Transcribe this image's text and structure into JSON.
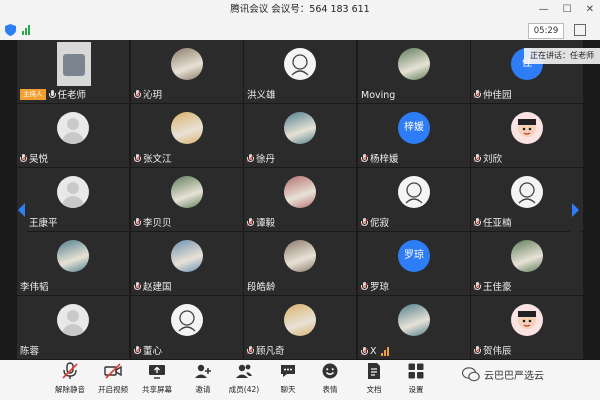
{
  "window": {
    "title": "腾讯会议  会议号：564 183 611"
  },
  "status": {
    "time": "05:29",
    "speaking": "正在讲话：任老师"
  },
  "colors": {
    "accent": "#2f7df6",
    "host_tag": "#f0a030",
    "tile_bg": "#2b2b2b",
    "grid_bg": "#1a1a1a"
  },
  "participants": [
    {
      "name": "任老师",
      "host_tag": "主持人",
      "mic": "on",
      "avatar": "photo-blurred"
    },
    {
      "name": "沁玥",
      "mic": "muted",
      "avatar": "photo"
    },
    {
      "name": "洪义雄",
      "mic": "none",
      "avatar": "drawing"
    },
    {
      "name": "Moving",
      "mic": "none",
      "avatar": "photo"
    },
    {
      "name": "仲佳园",
      "mic": "muted",
      "avatar": "text",
      "avatar_text": "佳"
    },
    {
      "name": "吴悦",
      "mic": "muted",
      "avatar": "default"
    },
    {
      "name": "张文江",
      "mic": "muted",
      "avatar": "photo"
    },
    {
      "name": "徐丹",
      "mic": "muted",
      "avatar": "photo"
    },
    {
      "name": "杨梓媛",
      "mic": "muted",
      "avatar": "text",
      "avatar_text": "梓媛"
    },
    {
      "name": "刘欣",
      "mic": "muted",
      "avatar": "cartoon"
    },
    {
      "name": "王康平",
      "mic": "muted",
      "avatar": "default"
    },
    {
      "name": "李贝贝",
      "mic": "muted",
      "avatar": "photo"
    },
    {
      "name": "谭毅",
      "mic": "muted",
      "avatar": "photo"
    },
    {
      "name": "伲寂",
      "mic": "muted",
      "avatar": "drawing"
    },
    {
      "name": "任亚楠",
      "mic": "muted",
      "avatar": "drawing"
    },
    {
      "name": "李伟韬",
      "mic": "none",
      "avatar": "photo"
    },
    {
      "name": "赵建国",
      "mic": "muted",
      "avatar": "photo"
    },
    {
      "name": "段皓龄",
      "mic": "none",
      "avatar": "photo"
    },
    {
      "name": "罗琼",
      "mic": "muted",
      "avatar": "text",
      "avatar_text": "罗琼"
    },
    {
      "name": "王佳豪",
      "mic": "muted",
      "avatar": "photo"
    },
    {
      "name": "陈蓉",
      "mic": "none",
      "avatar": "default"
    },
    {
      "name": "董心",
      "mic": "muted",
      "avatar": "drawing"
    },
    {
      "name": "顾凡奇",
      "mic": "muted",
      "avatar": "photo"
    },
    {
      "name": "X",
      "mic": "muted",
      "avatar": "photo",
      "signal": true
    },
    {
      "name": "贺伟辰",
      "mic": "muted",
      "avatar": "cartoon"
    }
  ],
  "toolbar": {
    "items": [
      {
        "label": "解除静音",
        "icon": "mic-muted-icon"
      },
      {
        "label": "开启视频",
        "icon": "video-off-icon"
      },
      {
        "label": "共享屏幕",
        "icon": "share-screen-icon"
      },
      {
        "label": "邀请",
        "icon": "invite-icon"
      },
      {
        "label": "成员(42)",
        "icon": "members-icon"
      },
      {
        "label": "聊天",
        "icon": "chat-icon"
      },
      {
        "label": "表情",
        "icon": "emoji-icon"
      },
      {
        "label": "文档",
        "icon": "document-icon"
      },
      {
        "label": "设置",
        "icon": "settings-icon"
      }
    ]
  },
  "watermark": {
    "text": "云巴巴严选云"
  }
}
